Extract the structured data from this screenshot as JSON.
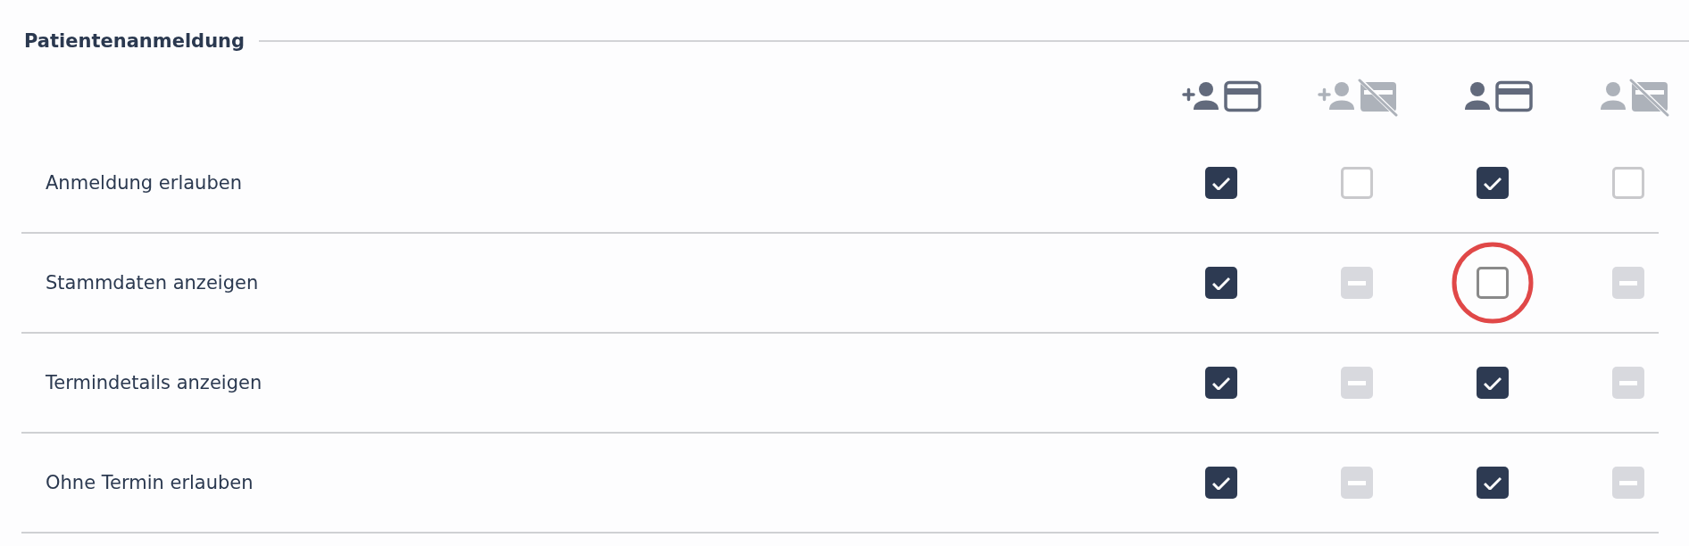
{
  "section": {
    "title": "Patientenanmeldung"
  },
  "columns": [
    {
      "plus": true,
      "card": true,
      "dimmed": false
    },
    {
      "plus": true,
      "card": false,
      "dimmed": true
    },
    {
      "plus": false,
      "card": true,
      "dimmed": false
    },
    {
      "plus": false,
      "card": false,
      "dimmed": true
    }
  ],
  "rows": [
    {
      "label": "Anmeldung erlauben",
      "cells": [
        {
          "checked": true,
          "disabled": false
        },
        {
          "checked": false,
          "disabled": false
        },
        {
          "checked": true,
          "disabled": false
        },
        {
          "checked": false,
          "disabled": false
        }
      ]
    },
    {
      "label": "Stammdaten anzeigen",
      "cells": [
        {
          "checked": true,
          "disabled": false
        },
        {
          "disabled": true
        },
        {
          "checked": false,
          "disabled": false,
          "highlighted": true
        },
        {
          "disabled": true
        }
      ]
    },
    {
      "label": "Termindetails anzeigen",
      "cells": [
        {
          "checked": true,
          "disabled": false
        },
        {
          "disabled": true
        },
        {
          "checked": true,
          "disabled": false
        },
        {
          "disabled": true
        }
      ]
    },
    {
      "label": "Ohne Termin erlauben",
      "cells": [
        {
          "checked": true,
          "disabled": false
        },
        {
          "disabled": true
        },
        {
          "checked": true,
          "disabled": false
        },
        {
          "disabled": true
        }
      ]
    }
  ]
}
